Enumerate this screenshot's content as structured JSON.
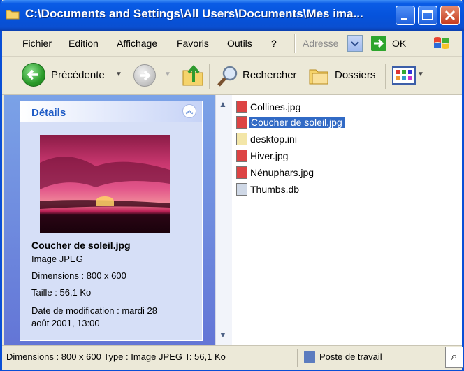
{
  "window": {
    "title": "C:\\Documents and Settings\\All Users\\Documents\\Mes ima..."
  },
  "menu": {
    "items": [
      "Fichier",
      "Edition",
      "Affichage",
      "Favoris",
      "Outils",
      "?"
    ],
    "address_label": "Adresse",
    "go_label": "OK"
  },
  "toolbar": {
    "back_label": "Précédente",
    "search_label": "Rechercher",
    "folders_label": "Dossiers"
  },
  "details": {
    "title": "Détails",
    "file_name": "Coucher de soleil.jpg",
    "file_type": "Image JPEG",
    "dimensions": "Dimensions : 800 x 600",
    "size": "Taille : 56,1 Ko",
    "modified_line1": "Date de modification : mardi 28",
    "modified_line2": "août 2001, 13:00"
  },
  "files": [
    {
      "name": "Collines.jpg",
      "type": "jpg",
      "selected": false
    },
    {
      "name": "Coucher de soleil.jpg",
      "type": "jpg",
      "selected": true
    },
    {
      "name": "desktop.ini",
      "type": "ini",
      "selected": false
    },
    {
      "name": "Hiver.jpg",
      "type": "jpg",
      "selected": false
    },
    {
      "name": "Nénuphars.jpg",
      "type": "jpg",
      "selected": false
    },
    {
      "name": "Thumbs.db",
      "type": "db",
      "selected": false
    }
  ],
  "status": {
    "left": "Dimensions : 800 x 600 Type : Image JPEG T: 56,1 Ko",
    "right": "Poste de travail"
  },
  "icons": {
    "title": "folder-icon",
    "back": "back-arrow-icon",
    "forward": "forward-arrow-icon",
    "up": "folder-up-icon",
    "search": "search-icon",
    "folders": "folders-icon",
    "views": "views-icon",
    "go": "go-arrow-icon",
    "windows": "windows-logo-icon",
    "collapse": "collapse-icon",
    "computer": "computer-icon",
    "magnifier": "magnifier-icon"
  }
}
